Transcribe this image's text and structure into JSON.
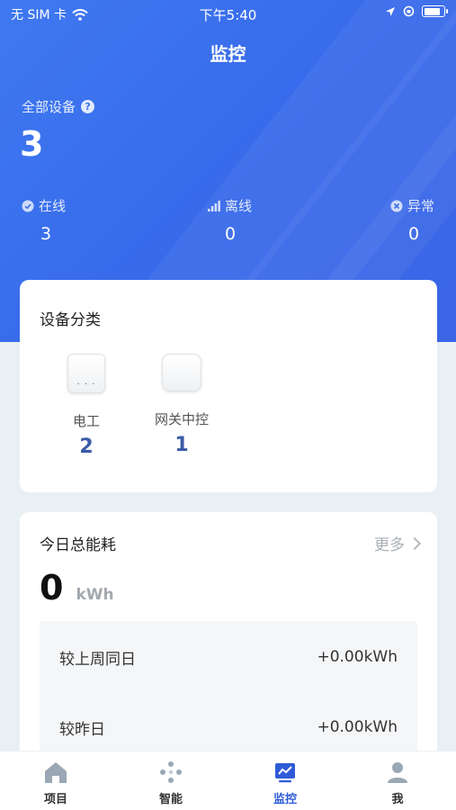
{
  "status_bar": {
    "carrier": "无 SIM 卡",
    "time": "下午5:40"
  },
  "nav": {
    "title": "监控"
  },
  "summary": {
    "all_label": "全部设备",
    "all_count": "3",
    "online_label": "在线",
    "online_count": "3",
    "offline_label": "离线",
    "offline_count": "0",
    "abnormal_label": "异常",
    "abnormal_count": "0"
  },
  "category": {
    "title": "设备分类",
    "items": [
      {
        "name": "电工",
        "count": "2"
      },
      {
        "name": "网关中控",
        "count": "1"
      }
    ]
  },
  "energy": {
    "title": "今日总能耗",
    "more_label": "更多",
    "value": "0",
    "unit": "kWh",
    "compare": [
      {
        "label": "较上周同日",
        "value": "+0.00kWh"
      },
      {
        "label": "较昨日",
        "value": "+0.00kWh"
      }
    ]
  },
  "tabs": [
    {
      "label": "项目",
      "icon": "home-icon"
    },
    {
      "label": "智能",
      "icon": "smart-dots-icon"
    },
    {
      "label": "监控",
      "icon": "chart-monitor-icon",
      "active": true
    },
    {
      "label": "我",
      "icon": "user-icon"
    }
  ],
  "colors": {
    "primary": "#3b6fe9",
    "active_tab": "#2f5bd8",
    "count_blue": "#3a5aa6"
  }
}
